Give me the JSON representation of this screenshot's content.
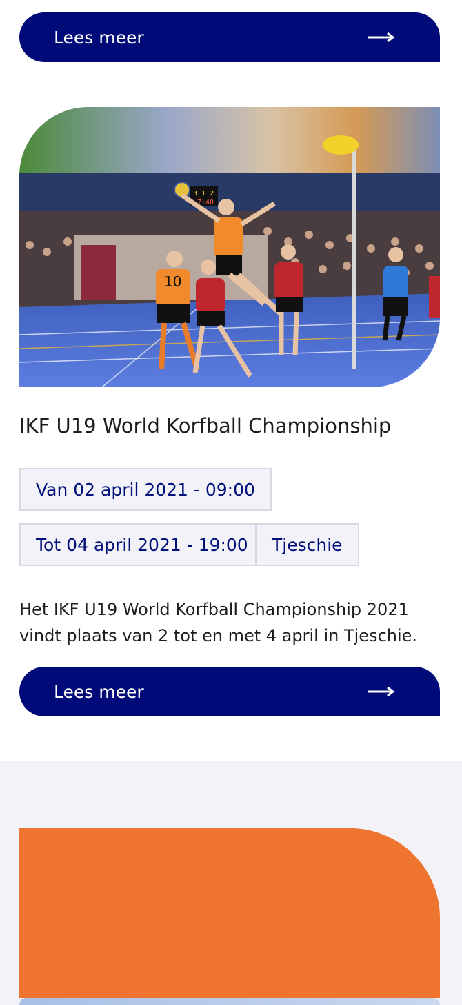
{
  "top_card": {
    "read_more_label": "Lees meer"
  },
  "event": {
    "title": "IKF U19 World Korfball Championship",
    "from_label": "Van 02 april 2021 - 09:00",
    "to_label": "Tot 04 april 2021 - 19:00",
    "location": "Tjeschie",
    "description": "Het IKF U19 World Korfball Championship 2021 vindt plaats van 2 tot en met 4 april in Tjeschie.",
    "read_more_label": "Lees meer",
    "image_alt": "korfball-match-photo",
    "jersey_number": "10",
    "scoreboard": "3 1 2",
    "scoreboard_time": "7:40"
  },
  "colors": {
    "primary_navy": "#000a78",
    "accent_orange": "#ee7430",
    "tag_bg": "#f2f2f8",
    "section_grey": "#f2f2f8"
  },
  "icons": {
    "read_more_arrow": "arrow-right-icon"
  }
}
